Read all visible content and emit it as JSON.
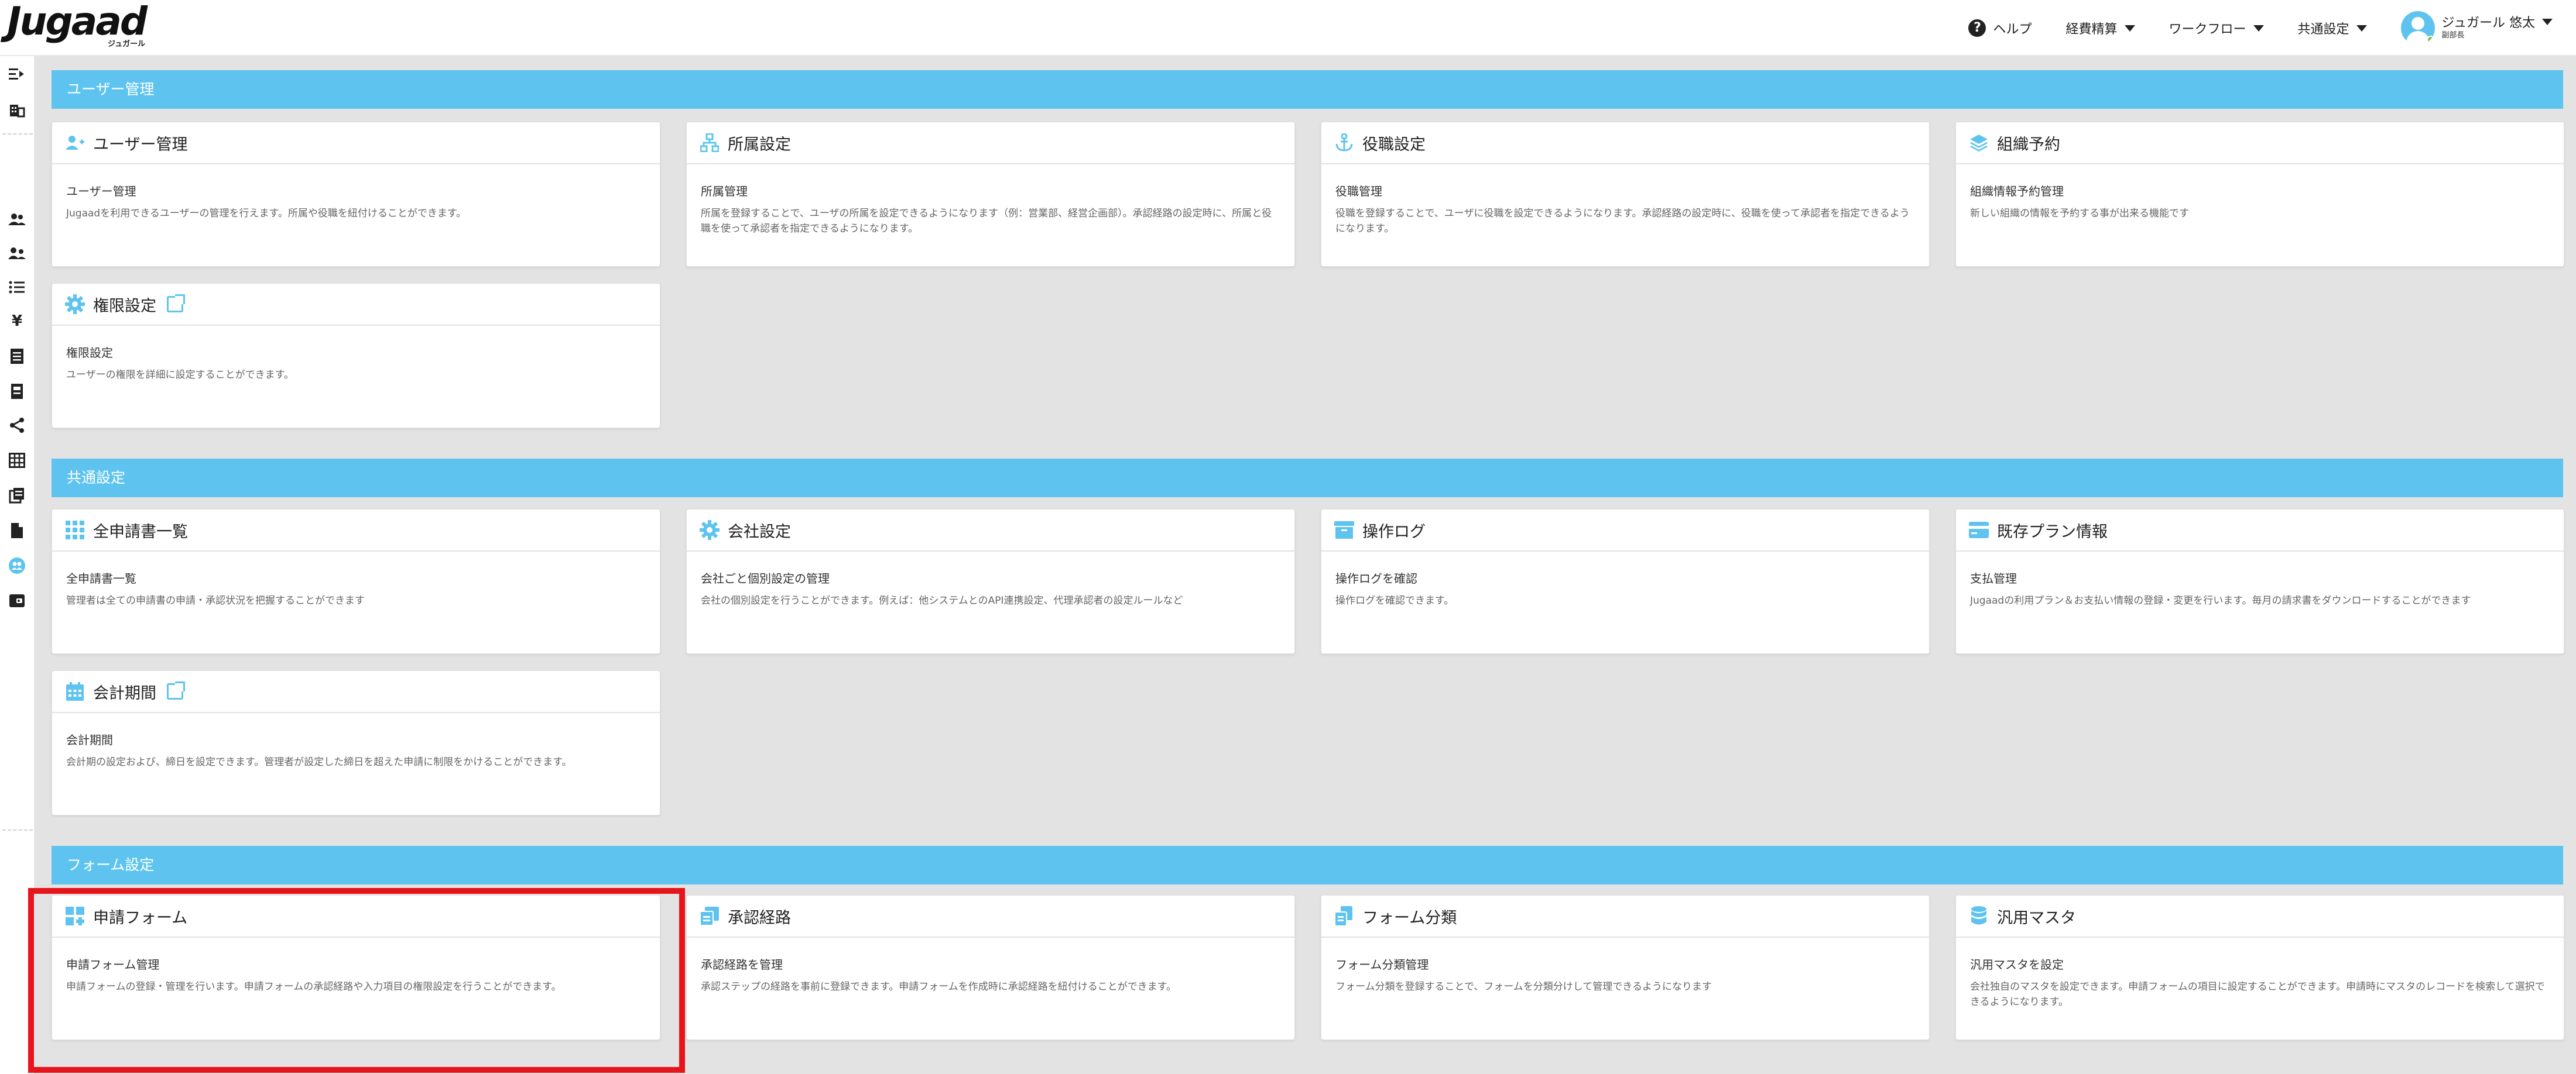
{
  "header": {
    "logo_text": "Jugaad",
    "logo_sub": "ジュガール",
    "help_label": "ヘルプ",
    "menus": [
      "経費精算",
      "ワークフロー",
      "共通設定"
    ],
    "user_name": "ジュガール 悠太",
    "user_role": "副部長"
  },
  "sections": [
    {
      "title": "ユーザー管理",
      "cards": [
        {
          "title": "ユーザー管理",
          "icon": "user-add-icon",
          "subtitle": "ユーザー管理",
          "desc": "Jugaadを利用できるユーザーの管理を行えます。所属や役職を紐付けることができます。"
        },
        {
          "title": "所属設定",
          "icon": "org-chart-icon",
          "subtitle": "所属管理",
          "desc": "所属を登録することで、ユーザの所属を設定できるようになります（例：営業部、経営企画部）。承認経路の設定時に、所属と役職を使って承認者を指定できるようになります。"
        },
        {
          "title": "役職設定",
          "icon": "anchor-icon",
          "subtitle": "役職管理",
          "desc": "役職を登録することで、ユーザに役職を設定できるようになります。承認経路の設定時に、役職を使って承認者を指定できるようになります。"
        },
        {
          "title": "組織予約",
          "icon": "layers-icon",
          "subtitle": "組織情報予約管理",
          "desc": "新しい組織の情報を予約する事が出来る機能です"
        },
        {
          "title": "権限設定",
          "icon": "gear-icon",
          "subtitle": "権限設定",
          "desc": "ユーザーの権限を詳細に設定することができます。",
          "external": true
        }
      ]
    },
    {
      "title": "共通設定",
      "cards": [
        {
          "title": "全申請書一覧",
          "icon": "grid-icon",
          "subtitle": "全申請書一覧",
          "desc": "管理者は全ての申請書の申請・承認状況を把握することができます"
        },
        {
          "title": "会社設定",
          "icon": "gear-icon",
          "subtitle": "会社ごと個別設定の管理",
          "desc": "会社の個別設定を行うことができます。例えば：他システムとのAPI連携設定、代理承認者の設定ルールなど"
        },
        {
          "title": "操作ログ",
          "icon": "archive-icon",
          "subtitle": "操作ログを確認",
          "desc": "操作ログを確認できます。"
        },
        {
          "title": "既存プラン情報",
          "icon": "card-icon",
          "subtitle": "支払管理",
          "desc": "Jugaadの利用プラン＆お支払い情報の登録・変更を行います。毎月の請求書をダウンロードすることができます"
        },
        {
          "title": "会計期間",
          "icon": "calendar-icon",
          "subtitle": "会計期間",
          "desc": "会計期の設定および、締日を設定できます。管理者が設定した締日を超えた申請に制限をかけることができます。",
          "external": true
        }
      ]
    },
    {
      "title": "フォーム設定",
      "cards": [
        {
          "title": "申請フォーム",
          "icon": "form-grid-icon",
          "subtitle": "申請フォーム管理",
          "desc": "申請フォームの登録・管理を行います。申請フォームの承認経路や入力項目の権限設定を行うことができます。"
        },
        {
          "title": "承認経路",
          "icon": "copy-icon",
          "subtitle": "承認経路を管理",
          "desc": "承認ステップの経路を事前に登録できます。申請フォームを作成時に承認経路を紐付けることができます。"
        },
        {
          "title": "フォーム分類",
          "icon": "folder-icon",
          "subtitle": "フォーム分類管理",
          "desc": "フォーム分類を登録することで、フォームを分類分けして管理できるようになります"
        },
        {
          "title": "汎用マスタ",
          "icon": "database-icon",
          "subtitle": "汎用マスタを設定",
          "desc": "会社独自のマスタを設定できます。申請フォームの項目に設定することができます。申請時にマスタのレコードを検索して選択できるようになります。"
        }
      ]
    }
  ],
  "colors": {
    "accent": "#5ec4ef",
    "highlight": "#e8141b",
    "background": "#e3e3e3"
  }
}
